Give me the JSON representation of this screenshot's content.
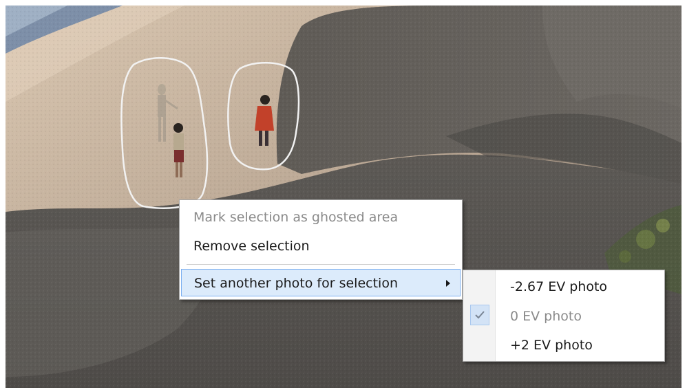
{
  "context_menu": {
    "items": [
      {
        "label": "Mark selection as ghosted area",
        "enabled": false
      },
      {
        "label": "Remove selection",
        "enabled": true
      },
      {
        "label": "Set another photo for selection",
        "enabled": true,
        "highlighted": true,
        "has_submenu": true
      }
    ]
  },
  "submenu": {
    "items": [
      {
        "label": "-2.67 EV photo",
        "checked": false,
        "enabled": true
      },
      {
        "label": "0 EV photo",
        "checked": true,
        "enabled": false
      },
      {
        "label": "+2 EV photo",
        "checked": false,
        "enabled": true
      }
    ]
  },
  "photo": {
    "selection_count": 2
  },
  "colors": {
    "highlight_bg": "#dcebfb",
    "highlight_border": "#7aaef0",
    "disabled_text": "#8a8a8a",
    "selection_outline": "#f2f2f2"
  }
}
